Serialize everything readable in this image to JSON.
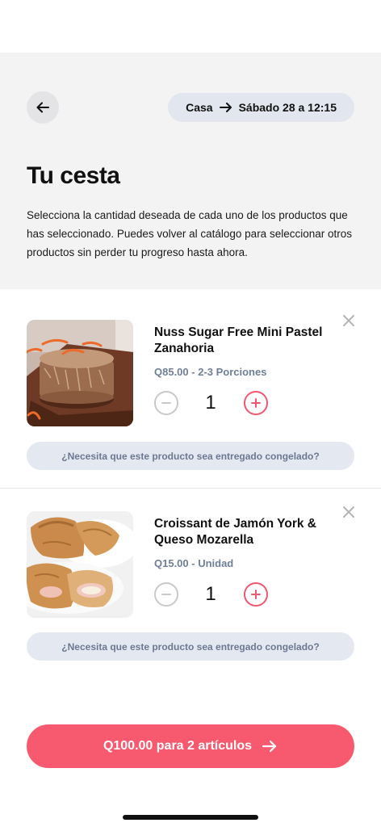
{
  "header": {
    "delivery_location": "Casa",
    "delivery_time": "Sábado 28 a 12:15",
    "title": "Tu cesta",
    "description": "Selecciona la cantidad deseada de cada uno de los productos que has seleccionado. Puedes volver al catálogo para seleccionar otros productos sin perder tu progreso hasta ahora."
  },
  "cart": {
    "items": [
      {
        "name": "Nuss Sugar Free Mini Pastel Zanahoria",
        "price": "Q85.00 - 2-3 Porciones",
        "quantity": "1",
        "frozen_question": "¿Necesita que este producto sea entregado congelado?",
        "image": "carrot-cake-photo"
      },
      {
        "name": "Croissant de Jamón York & Queso Mozarella",
        "price": "Q15.00 - Unidad",
        "quantity": "1",
        "frozen_question": "¿Necesita que este producto sea entregado congelado?",
        "image": "croissant-photo"
      }
    ]
  },
  "checkout": {
    "label": "Q100.00 para 2 artículos"
  },
  "colors": {
    "accent": "#f7596f",
    "header_bg": "#f3f3f4",
    "pill_bg": "#e2e6ee",
    "price_text": "#6f7f99"
  }
}
